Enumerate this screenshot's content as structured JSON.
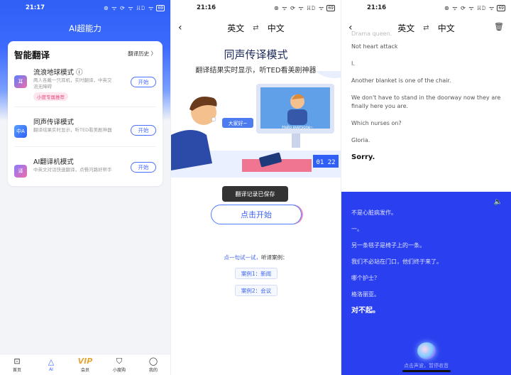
{
  "panel1": {
    "status": {
      "time": "21:17",
      "icons": "⊛ ᯤ ⟳ ᯤ 𝙷𝙳 ᯤ",
      "battery": "69"
    },
    "title": "AI超能力",
    "card_title": "智能翻译",
    "history": "翻译历史 〉",
    "modes": [
      {
        "name": "流浪地球模式 ⓘ",
        "desc": "两人各戴一只耳机，实时翻译，中英交流无障碍",
        "tag": "小度专属推荐",
        "btn": "开始",
        "icon": "耳"
      },
      {
        "name": "同声传译模式",
        "desc": "翻译结果实时显示，听TED看美剧神器",
        "tag": "",
        "btn": "开始",
        "icon": "中A"
      },
      {
        "name": "AI翻译机模式",
        "desc": "中英文对话快速翻译，点餐问路好帮手",
        "tag": "",
        "btn": "开始",
        "icon": "译"
      }
    ],
    "tabs": [
      {
        "label": "首页",
        "icon": "⊡"
      },
      {
        "label": "AI",
        "icon": "△"
      },
      {
        "label": "会员",
        "icon": "VIP"
      },
      {
        "label": "小度购",
        "icon": "⛉"
      },
      {
        "label": "我的",
        "icon": "◯"
      }
    ]
  },
  "panel2": {
    "status": {
      "time": "21:16",
      "icons": "⊛ ᯤ ⟳ ᯤ 𝙷𝙳 ᯤ",
      "battery": "69"
    },
    "lang_from": "英文",
    "lang_to": "中文",
    "heading": "同声传译模式",
    "subheading": "翻译结果实时显示，听TED看美剧神器",
    "bubble": "大家好~",
    "screen_text": "Hello everyone~",
    "clock": "01 22",
    "toast": "翻译记录已保存",
    "start": "点击开始",
    "try_link": "点一句试一试，",
    "try_rest": "听译案例：",
    "case1": "案例1：新闻",
    "case2": "案例2：会议"
  },
  "panel3": {
    "status": {
      "time": "21:16",
      "icons": "⊛ ᯤ ⟳ ᯤ 𝙷𝙳 ᯤ",
      "battery": "69"
    },
    "lang_from": "英文",
    "lang_to": "中文",
    "english": [
      "Drama queen.",
      "Not heart attack",
      "I.",
      "Another blanket is one of the chair.",
      "We don't have to stand in the doorway now they are finally here you are.",
      "Which nurses on?",
      "Gloria.",
      "Sorry."
    ],
    "chinese": [
      "不是心脏病发作。",
      "一。",
      "另一条毯子是椅子上的一条。",
      "我们不必站在门口，他们终于来了。",
      "哪个护士？",
      "格洛丽亚。",
      "对不起。"
    ],
    "hint": "点击声波，暂停收音"
  },
  "colors": {
    "accent": "#3d6bff",
    "blue_panel": "#2a3fef",
    "tag_pink": "#e94d7d"
  }
}
